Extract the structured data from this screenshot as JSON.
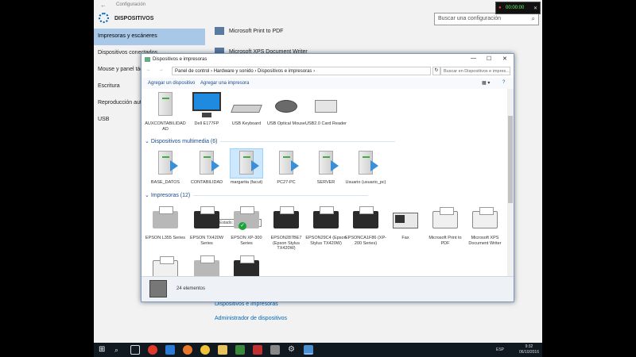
{
  "settings": {
    "title": "Configuración",
    "header": "DISPOSITIVOS",
    "search_placeholder": "Buscar una configuración",
    "nav": [
      {
        "label": "Impresoras y escáneres",
        "active": true
      },
      {
        "label": "Dispositivos conectados",
        "active": false
      },
      {
        "label": "Mouse y panel táctil",
        "active": false
      },
      {
        "label": "Escritura",
        "active": false
      },
      {
        "label": "Reproducción automática",
        "active": false
      },
      {
        "label": "USB",
        "active": false
      }
    ],
    "content_items": [
      "Microsoft Print to PDF",
      "Microsoft XPS Document Writer"
    ],
    "links": [
      "Dispositivos e impresoras",
      "Administrador de dispositivos"
    ]
  },
  "recorder": {
    "time": "00:00:00"
  },
  "devices_window": {
    "title": "Dispositivos e impresoras",
    "breadcrumb": "Panel de control  ›  Hardware y sonido  ›  Dispositivos e impresoras  ›",
    "search_placeholder": "Buscar en Dispositivos e impres...",
    "commands": [
      "Agregar un dispositivo",
      "Agregar una impresora"
    ],
    "devices": [
      {
        "label": "AUXCONTABILIDAD AD",
        "icon": "computer-tower-icon"
      },
      {
        "label": "Dell E177FP",
        "icon": "monitor-icon"
      },
      {
        "label": "USB Keyboard",
        "icon": "keyboard-icon"
      },
      {
        "label": "USB Optical Mouse",
        "icon": "mouse-icon"
      },
      {
        "label": "USB2.0 Card Reader",
        "icon": "card-reader-icon"
      }
    ],
    "multimedia_header": "Dispositivos multimedia (6)",
    "multimedia": [
      {
        "label": "BASE_DATOS"
      },
      {
        "label": "CONTABILIDAD"
      },
      {
        "label": "margarita (facut)"
      },
      {
        "label": "PC27-PC"
      },
      {
        "label": "SERVER"
      },
      {
        "label": "Usuario (usuario_pc)"
      }
    ],
    "tooltip": "Estado: No conectado",
    "printers_header": "Impresoras (12)",
    "printers": [
      {
        "label": "EPSON L355 Series",
        "style": "gray"
      },
      {
        "label": "EPSON TX420W Series",
        "style": "black"
      },
      {
        "label": "EPSON XP-300 Series",
        "style": "gray"
      },
      {
        "label": "EPSON287BE7 (Epson Stylus TX420W)",
        "style": "black"
      },
      {
        "label": "EPSON29C4 (Epson Stylus TX420W)",
        "style": "black"
      },
      {
        "label": "EPSONCA1F86 (XP-200 Series)",
        "style": "black"
      },
      {
        "label": "Fax",
        "style": "fax"
      },
      {
        "label": "Microsoft Print to PDF",
        "style": "white"
      },
      {
        "label": "Microsoft XPS Document Writer",
        "style": "white"
      }
    ],
    "status_count": "24 elementos"
  },
  "taskbar": {
    "language": "ESP",
    "time": "9:32",
    "date": "06/10/2016"
  }
}
